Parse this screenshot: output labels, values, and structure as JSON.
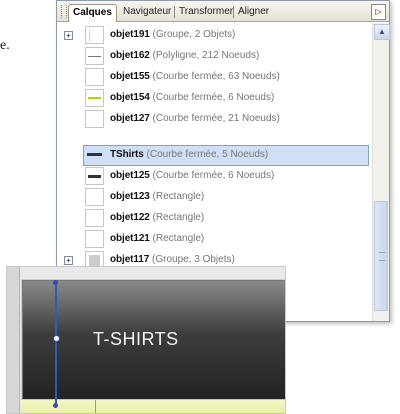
{
  "stray_text": "e.",
  "panel": {
    "tabs": [
      "Calques",
      "Navigateur",
      "Transformer",
      "Aligner"
    ],
    "menu_arrow": "▷",
    "rows": [
      {
        "name": "objet191",
        "detail": " (Groupe, 2 Objets)",
        "expand": true,
        "thumb": "dots",
        "selected": false
      },
      {
        "name": "objet162",
        "detail": " (Polyligne, 212 Noeuds)",
        "expand": false,
        "thumb": "thin",
        "selected": false
      },
      {
        "name": "objet155",
        "detail": " (Courbe fermée, 63 Noeuds)",
        "expand": false,
        "thumb": "none",
        "selected": false
      },
      {
        "name": "objet154",
        "detail": " (Courbe fermée, 6 Noeuds)",
        "expand": false,
        "thumb": "green",
        "selected": false
      },
      {
        "name": "objet127",
        "detail": " (Courbe fermée, 21 Noeuds)",
        "expand": false,
        "thumb": "none",
        "selected": false
      },
      {
        "name": "TShirts",
        "detail": " (Courbe fermée, 5 Noeuds)",
        "expand": false,
        "thumb": "thick",
        "selected": true
      },
      {
        "name": "objet125",
        "detail": " (Courbe fermée, 6 Noeuds)",
        "expand": false,
        "thumb": "thick",
        "selected": false
      },
      {
        "name": "objet123",
        "detail": " (Rectangle)",
        "expand": false,
        "thumb": "none",
        "selected": false
      },
      {
        "name": "objet122",
        "detail": " (Rectangle)",
        "expand": false,
        "thumb": "none",
        "selected": false
      },
      {
        "name": "objet121",
        "detail": " (Rectangle)",
        "expand": false,
        "thumb": "none",
        "selected": false
      },
      {
        "name": "objet117",
        "detail": " (Groupe, 3 Objets)",
        "expand": true,
        "thumb": "grey",
        "selected": false
      }
    ],
    "expand_symbol": "+",
    "scroll_up": "▲"
  },
  "canvas": {
    "tab_label": "T-SHIRTS"
  }
}
